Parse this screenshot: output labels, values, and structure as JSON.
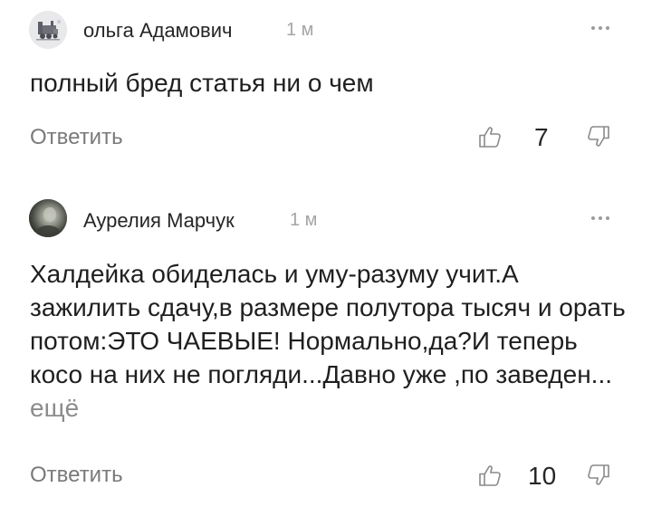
{
  "comments": [
    {
      "author": "ольга Адамович",
      "time": "1 м",
      "avatar_icon": "steam-locomotive-icon",
      "text": "полный бред статья ни о чем",
      "more_link": "",
      "reply_label": "Ответить",
      "likes": "7"
    },
    {
      "author": "Аурелия Марчук",
      "time": "1 м",
      "avatar_icon": "user-photo",
      "text": "Халдейка обиделась и уму-разуму учит.А зажилить сдачу,в размере полутора тысяч и орать потом:ЭТО ЧАЕВЫЕ! Нормально,да?И теперь косо на них не погляди...Давно уже ,по заведен...",
      "more_link": "ещё",
      "reply_label": "Ответить",
      "likes": "10"
    }
  ],
  "colors": {
    "text": "#1f1f1f",
    "muted": "#a5a5a5",
    "reply": "#7a7a7a"
  }
}
